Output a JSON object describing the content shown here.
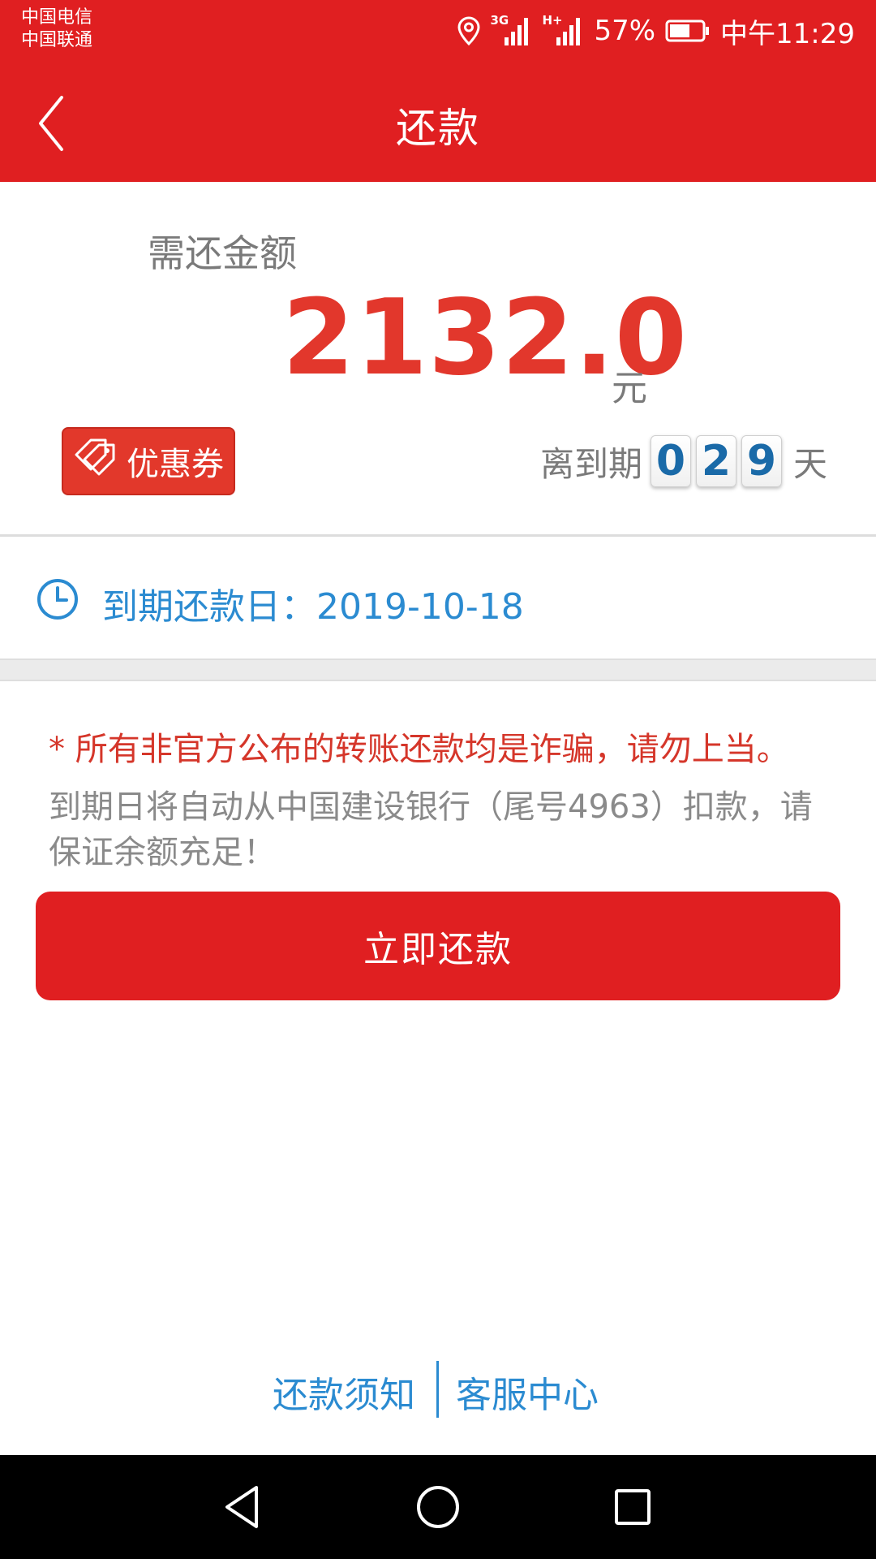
{
  "status_bar": {
    "carrier1": "中国电信",
    "carrier2": "中国联通",
    "network1": "3G",
    "network2": "H+",
    "battery": "57%",
    "time": "中午11:29"
  },
  "header": {
    "title": "还款"
  },
  "amount": {
    "label": "需还金额",
    "value": "2132.0",
    "unit": "元"
  },
  "coupon": {
    "label": "优惠券"
  },
  "countdown": {
    "label": "离到期",
    "digits": [
      "0",
      "2",
      "9"
    ],
    "unit": "天"
  },
  "due": {
    "text": "到期还款日：2019-10-18"
  },
  "notice": {
    "warning": "* 所有非官方公布的转账还款均是诈骗，请勿上当。",
    "info": "到期日将自动从中国建设银行（尾号4963）扣款，请保证余额充足！"
  },
  "repay_button": {
    "label": "立即还款"
  },
  "footer": {
    "repay_notice": "还款须知",
    "customer_service": "客服中心"
  },
  "colors": {
    "brand_red": "#e01f21",
    "link_blue": "#2b8bd1",
    "amount_red": "#e2372c"
  }
}
